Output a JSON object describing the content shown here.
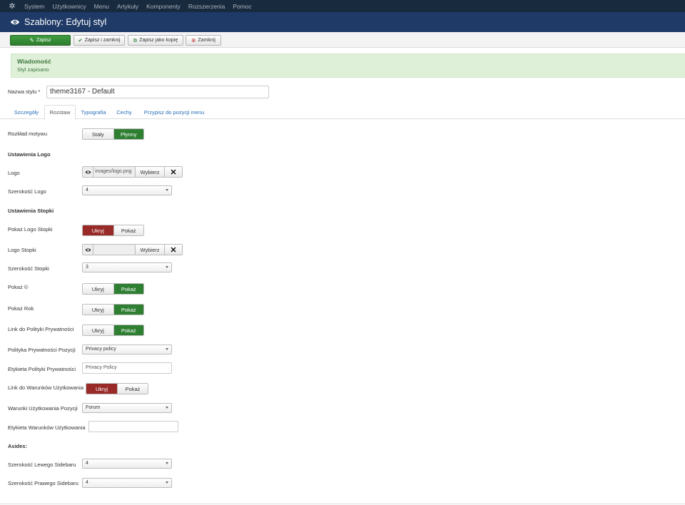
{
  "navbar": {
    "items": [
      "System",
      "Użytkownicy",
      "Menu",
      "Artykuły",
      "Komponenty",
      "Rozszerzenia",
      "Pomoc"
    ]
  },
  "header": {
    "title": "Szablony: Edytuj styl"
  },
  "toolbar": {
    "save": "Zapisz",
    "save_close": "Zapisz i zamknij",
    "save_copy": "Zapisz jako kopię",
    "close": "Zamknij"
  },
  "alert": {
    "heading": "Wiadomość",
    "text": "Styl zapisano"
  },
  "style_name": {
    "label": "Nazwa stylu *",
    "value": "theme3167 - Default"
  },
  "tabs": [
    "Szczegóły",
    "Rozstaw",
    "Typografia",
    "Cechy",
    "Przypisz do pozycji menu"
  ],
  "form": {
    "layout_label": "Rozkład motywu",
    "layout_options": [
      "Stały",
      "Płynny"
    ],
    "logo_section": "Ustawienia Logo",
    "logo_label": "Logo",
    "logo_path": "images/logo.png",
    "select_btn": "Wybierz",
    "logo_width_label": "Szerokość Logo",
    "logo_width_value": "4",
    "footer_section": "Ustawienia Stopki",
    "show_footer_logo_label": "Pokaż Logo Stopki",
    "hide": "Ukryj",
    "show": "Pokaż",
    "footer_logo_label": "Logo Stopki",
    "footer_logo_path": "",
    "footer_width_label": "Szerokość Stopki",
    "footer_width_value": "3",
    "show_copy_label": "Pokaż ©",
    "show_year_label": "Pokaż Rok",
    "privacy_link_label": "Link do Polityki Prywatności",
    "privacy_position_label": "Polityka Prywatności Pozycji",
    "privacy_position_value": "Privacy policy",
    "privacy_tag_label": "Etykieta Polityki Prywatności",
    "privacy_tag_value": "Privacy Policy",
    "terms_link_label": "Link do Warunków Użytkowania",
    "terms_position_label": "Warunki Użytkowania Pozycji",
    "terms_position_value": "Forum",
    "terms_tag_label": "Etykieta Warunków Użytkowania",
    "terms_tag_value": "",
    "asides_section": "Asides:",
    "left_sidebar_label": "Szerokość Lewego Sidebaru",
    "left_sidebar_value": "4",
    "right_sidebar_label": "Szerokość Prawego Sidebaru",
    "right_sidebar_value": "4"
  },
  "colors": {
    "navbar": "#182a3e",
    "header": "#1f3a66",
    "green": "#2f7f33",
    "red": "#982a27",
    "alert_bg": "#dff0d8",
    "link": "#2a6fb7"
  }
}
